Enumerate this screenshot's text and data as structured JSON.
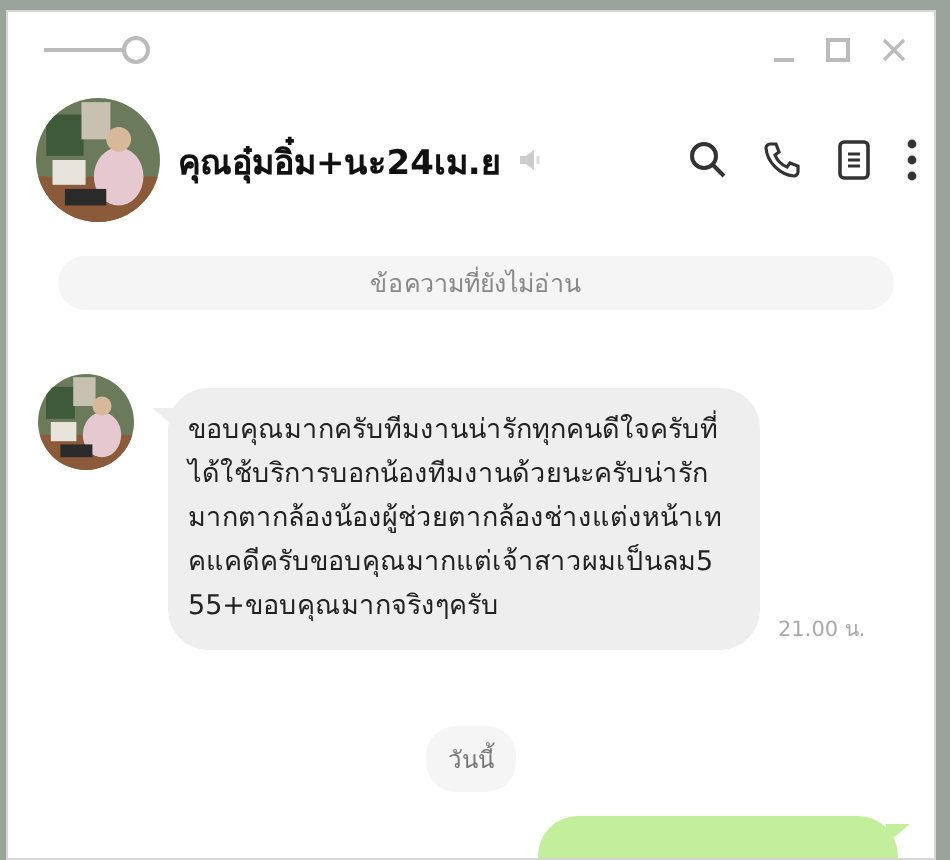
{
  "header": {
    "contact_name": "คุณอุ๋มอิ๋ม+นะ24เม.ย",
    "muted": true
  },
  "unread_divider": "ข้อความที่ยังไม่อ่าน",
  "messages": [
    {
      "kind": "incoming",
      "text": "ขอบคุณมากครับทีมงานน่ารักทุกคนดีใจครับที่ได้ใช้บริการบอกน้องทีมงานด้วยนะครับน่ารักมากตากล้องน้องผู้ช่วยตากล้องช่างแต่งหน้าเทคแคดีครับขอบคุณมากแต่เจ้าสาวผมเป็นลม555+ขอบคุณมากจริงๆครับ",
      "time": "21.00 น."
    },
    {
      "kind": "date",
      "text": "วันนี้"
    },
    {
      "kind": "outgoing"
    }
  ]
}
